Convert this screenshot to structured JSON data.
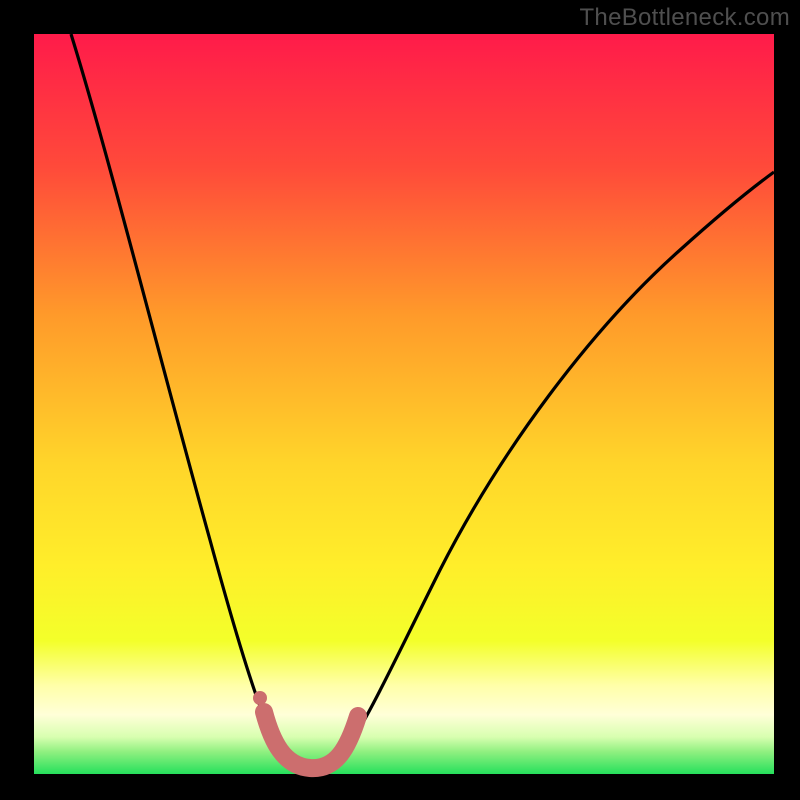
{
  "watermark": {
    "text": "TheBottleneck.com"
  },
  "chart_data": {
    "type": "line",
    "title": "",
    "xlabel": "",
    "ylabel": "",
    "xlim": [
      0,
      100
    ],
    "ylim": [
      0,
      100
    ],
    "background_gradient": {
      "top": "#ff1f4a",
      "mid_upper": "#ff9a2a",
      "mid": "#ffe22a",
      "mid_lower": "#f6ff2a",
      "band": "#ffffb0",
      "bottom": "#26e05c"
    },
    "curve_color": "#000000",
    "marker_color": "#cc6e6e",
    "minimum_region_x": [
      32,
      42
    ],
    "series": [
      {
        "name": "bottleneck-curve",
        "x": [
          5,
          8,
          11,
          14,
          17,
          20,
          23,
          26,
          29,
          31,
          33,
          35,
          37,
          39,
          41,
          43,
          46,
          50,
          55,
          60,
          66,
          72,
          78,
          85,
          92,
          100
        ],
        "y": [
          100,
          88,
          76,
          65,
          55,
          46,
          38,
          30,
          22,
          14,
          8,
          4,
          2,
          2,
          4,
          8,
          14,
          22,
          31,
          39,
          47,
          54,
          60,
          66,
          71,
          75
        ]
      }
    ],
    "valley_markers": {
      "x": [
        31.5,
        33,
        34.5,
        36,
        37.5,
        39,
        40.5,
        42
      ],
      "y": [
        9,
        5,
        3,
        2,
        2,
        3,
        5,
        9
      ]
    }
  }
}
